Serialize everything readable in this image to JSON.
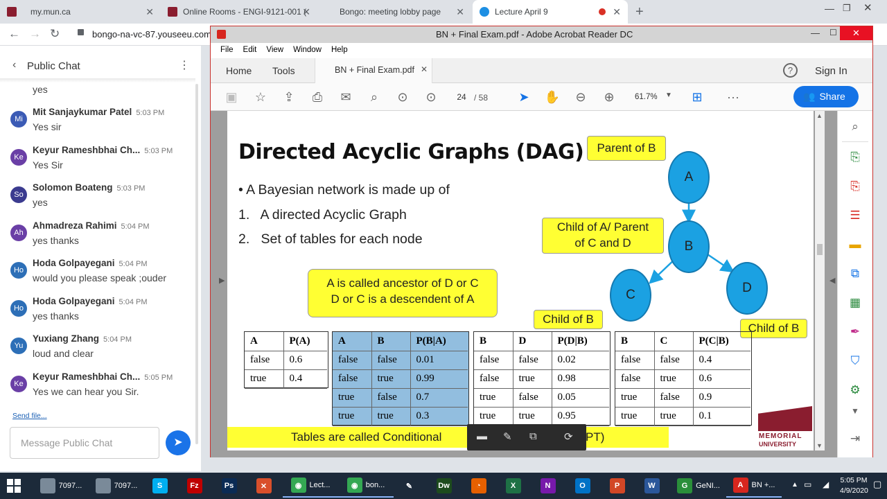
{
  "browser": {
    "tabs": [
      {
        "label": "my.mun.ca",
        "favicon": "mun-icon",
        "color": "#8a1d2f"
      },
      {
        "label": "Online Rooms - ENGI-9121-001 (",
        "favicon": "mun-icon",
        "color": "#8a1d2f"
      },
      {
        "label": "Bongo: meeting lobby page",
        "favicon": "bongo-icon",
        "color": "#ffffff"
      },
      {
        "label": "Lecture April 9",
        "favicon": "bongo-icon",
        "color": "#1d8fe3"
      }
    ],
    "new_tab": "+",
    "url": "bongo-na-vc-87.youseeu.com"
  },
  "chat": {
    "title": "Public Chat",
    "first_text": "yes",
    "messages": [
      {
        "initials": "Mi",
        "name": "Mit Sanjaykumar Patel",
        "time": "5:03 PM",
        "text": "Yes sir",
        "color": "#3b5bb5"
      },
      {
        "initials": "Ke",
        "name": "Keyur Rameshbhai Ch...",
        "time": "5:03 PM",
        "text": "Yes Sir",
        "color": "#6a3fa6"
      },
      {
        "initials": "So",
        "name": "Solomon Boateng",
        "time": "5:03 PM",
        "text": "yes",
        "color": "#3b3b8f"
      },
      {
        "initials": "Ah",
        "name": "Ahmadreza Rahimi",
        "time": "5:04 PM",
        "text": "yes thanks",
        "color": "#6a3fa6"
      },
      {
        "initials": "Ho",
        "name": "Hoda Golpayegani",
        "time": "5:04 PM",
        "text": "would you please speak ;ouder",
        "color": "#2d6fb7"
      },
      {
        "initials": "Ho",
        "name": "Hoda Golpayegani",
        "time": "5:04 PM",
        "text": "yes thanks",
        "color": "#2d6fb7"
      },
      {
        "initials": "Yu",
        "name": "Yuxiang Zhang",
        "time": "5:04 PM",
        "text": "loud and clear",
        "color": "#2d6fb7"
      },
      {
        "initials": "Ke",
        "name": "Keyur Rameshbhai Ch...",
        "time": "5:05 PM",
        "text": "Yes we can hear you Sir.",
        "color": "#6a3fa6"
      }
    ],
    "send_file": "Send file...",
    "placeholder": "Message Public Chat"
  },
  "acrobat": {
    "title": "BN + Final Exam.pdf - Adobe Acrobat Reader DC",
    "menu": [
      "File",
      "Edit",
      "View",
      "Window",
      "Help"
    ],
    "home": "Home",
    "tools": "Tools",
    "doc_tab": "BN + Final Exam.pdf",
    "sign_in": "Sign In",
    "page_current": "24",
    "page_total": "/ 58",
    "zoom": "61.7%",
    "share": "Share"
  },
  "slide": {
    "title": "Directed Acyclic Graphs (DAG)",
    "bullet": "• A Bayesian network is made up of",
    "items": [
      "1.   A directed Acyclic Graph",
      "2.   Set of tables for each node"
    ],
    "ancestor_line1": "A is called ancestor of D or C",
    "ancestor_line2": "D or C is a descendent of A",
    "parent_of_b": "Parent of B",
    "child_parent_line1": "Child of A/ Parent",
    "child_parent_line2": "of C and D",
    "child_of_b_1": "Child of B",
    "child_of_b_2": "Child of B",
    "nodes": {
      "a": "A",
      "b": "B",
      "c": "C",
      "d": "D"
    },
    "bottom_text": "Tables are called Conditional",
    "bottom_suffix": "PT)",
    "logo_line1": "MEMORIAL",
    "logo_line2": "UNIVERSITY",
    "table_pa": [
      [
        "A",
        "P(A)"
      ],
      [
        "false",
        "0.6"
      ],
      [
        "true",
        "0.4"
      ]
    ],
    "table_pba": [
      [
        "A",
        "B",
        "P(B|A)"
      ],
      [
        "false",
        "false",
        "0.01"
      ],
      [
        "false",
        "true",
        "0.99"
      ],
      [
        "true",
        "false",
        "0.7"
      ],
      [
        "true",
        "true",
        "0.3"
      ]
    ],
    "table_pdb": [
      [
        "B",
        "D",
        "P(D|B)"
      ],
      [
        "false",
        "false",
        "0.02"
      ],
      [
        "false",
        "true",
        "0.98"
      ],
      [
        "true",
        "false",
        "0.05"
      ],
      [
        "true",
        "true",
        "0.95"
      ]
    ],
    "table_pcb": [
      [
        "B",
        "C",
        "P(C|B)"
      ],
      [
        "false",
        "false",
        "0.4"
      ],
      [
        "false",
        "true",
        "0.6"
      ],
      [
        "true",
        "false",
        "0.9"
      ],
      [
        "true",
        "true",
        "0.1"
      ]
    ]
  },
  "taskbar": {
    "items": [
      {
        "label": "7097...",
        "icon": "scanner-icon",
        "color": "#7a8a99"
      },
      {
        "label": "7097...",
        "icon": "scanner-icon",
        "color": "#7a8a99"
      },
      {
        "label": "",
        "icon": "skype-icon",
        "color": "#00aff0",
        "glyph": "S"
      },
      {
        "label": "",
        "icon": "filezilla-icon",
        "color": "#bf0000",
        "glyph": "Fz"
      },
      {
        "label": "",
        "icon": "photoshop-icon",
        "color": "#0b2b54",
        "glyph": "Ps"
      },
      {
        "label": "",
        "icon": "tool-icon",
        "color": "#d94f2b",
        "glyph": "✕"
      },
      {
        "label": "Lect...",
        "icon": "chrome-icon",
        "color": "#34a853",
        "glyph": "◉"
      },
      {
        "label": "bon...",
        "icon": "chrome-icon",
        "color": "#34a853",
        "glyph": "◉"
      },
      {
        "label": "",
        "icon": "pen-icon",
        "color": "#1c2a3a",
        "glyph": "✎"
      },
      {
        "label": "",
        "icon": "dreamweaver-icon",
        "color": "#1d4b1d",
        "glyph": "Dw"
      },
      {
        "label": "",
        "icon": "firefox-icon",
        "color": "#e66000",
        "glyph": "◔"
      },
      {
        "label": "",
        "icon": "excel-icon",
        "color": "#1e7145",
        "glyph": "X"
      },
      {
        "label": "",
        "icon": "onenote-icon",
        "color": "#7719aa",
        "glyph": "N"
      },
      {
        "label": "",
        "icon": "outlook-icon",
        "color": "#0072c6",
        "glyph": "O"
      },
      {
        "label": "",
        "icon": "powerpoint-icon",
        "color": "#d24726",
        "glyph": "P"
      },
      {
        "label": "",
        "icon": "word-icon",
        "color": "#2b579a",
        "glyph": "W"
      },
      {
        "label": "GeNI...",
        "icon": "genie-icon",
        "color": "#2a8f3a",
        "glyph": "G"
      },
      {
        "label": "BN +...",
        "icon": "acrobat-icon",
        "color": "#d7261e",
        "glyph": "A"
      }
    ],
    "time": "5:05 PM",
    "date": "4/9/2020"
  }
}
